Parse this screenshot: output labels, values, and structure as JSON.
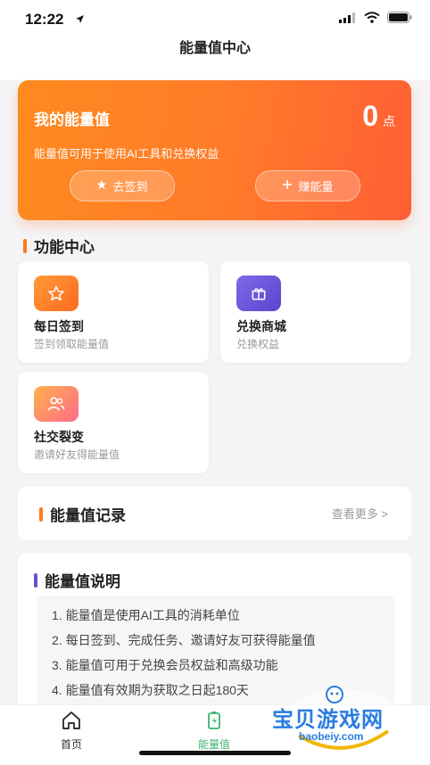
{
  "status": {
    "time": "12:22"
  },
  "nav": {
    "title": "能量值中心"
  },
  "energy": {
    "title": "我的能量值",
    "value": "0",
    "unit": "点",
    "description": "能量值可用于使用AI工具和兑换权益",
    "checkin_label": "去签到",
    "earn_label": "赚能量"
  },
  "features": {
    "section_title": "功能中心",
    "items": [
      {
        "name": "每日签到",
        "desc": "签到领取能量值"
      },
      {
        "name": "兑换商城",
        "desc": "兑换权益"
      },
      {
        "name": "社交裂变",
        "desc": "邀请好友得能量值"
      }
    ]
  },
  "records": {
    "title": "能量值记录",
    "more_label": "查看更多 >"
  },
  "explain": {
    "title": "能量值说明",
    "items": [
      "1. 能量值是使用AI工具的消耗单位",
      "2. 每日签到、完成任务、邀请好友可获得能量值",
      "3. 能量值可用于兑换会员权益和高级功能",
      "4. 能量值有效期为获取之日起180天"
    ]
  },
  "tabs": [
    {
      "label": "首页",
      "icon": "home-icon",
      "active": false
    },
    {
      "label": "能量值",
      "icon": "battery-icon",
      "active": true
    }
  ],
  "watermark": {
    "text": "宝贝游戏网",
    "sub": "baobeiy.com"
  },
  "colors": {
    "accent_orange": "#ff7a2a",
    "active_tab": "#3cb371",
    "records_bar": "#ff7a1a",
    "explain_bar": "#6a4fd6"
  }
}
